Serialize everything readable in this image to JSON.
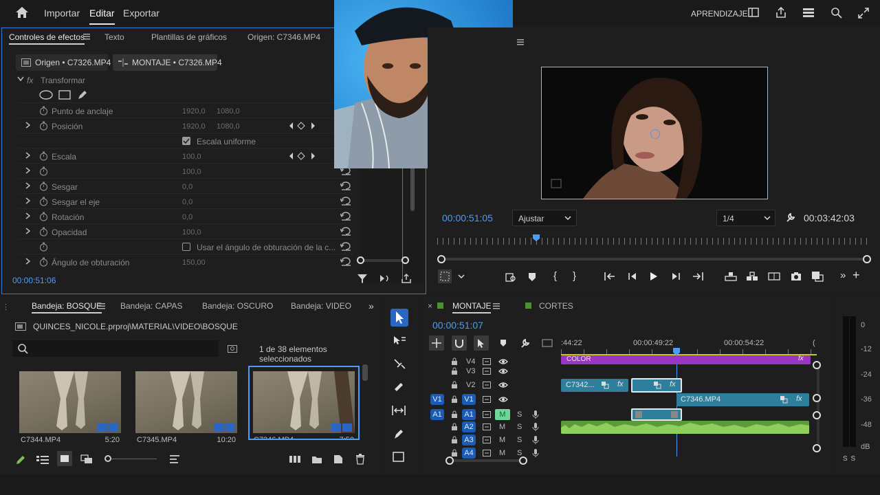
{
  "colors": {
    "accent": "#4d9cf6",
    "track_badge": "#1b5bb4",
    "clip_teal": "#2e7f9c",
    "clip_purple": "#9a35c4",
    "audio_green": "#7fbd52"
  },
  "top": {
    "nav": [
      "Importar",
      "Editar",
      "Exportar"
    ],
    "active": "Editar",
    "learning": "APRENDIZAJE"
  },
  "effects": {
    "tabs": [
      "Controles de efectos",
      "Texto",
      "Plantillas de gráficos",
      "Origen: C7346.MP4"
    ],
    "source_btn": "Origen • C7326.MP4",
    "sequence_btn": "MONTAJE • C7326.MP4",
    "section": "Transformar",
    "rows": [
      {
        "name": "Punto de anclaje",
        "v1": "1920,0",
        "v2": "1080,0",
        "chev": false,
        "kf": false,
        "reset": false
      },
      {
        "name": "Posición",
        "v1": "1920,0",
        "v2": "1080,0",
        "chev": true,
        "kf": true,
        "reset": false
      },
      {
        "name": "",
        "v1": "",
        "v2": "",
        "chev": false,
        "kf": false,
        "reset": false,
        "checkbox": true,
        "check_label": "Escala uniforme"
      },
      {
        "name": "Escala",
        "v1": "100,0",
        "v2": "",
        "chev": true,
        "kf": true,
        "reset": false
      },
      {
        "name": "",
        "v1": "100,0",
        "v2": "",
        "chev": true,
        "kf": false,
        "reset": true
      },
      {
        "name": "Sesgar",
        "v1": "0,0",
        "v2": "",
        "chev": true,
        "kf": false,
        "reset": true
      },
      {
        "name": "Sesgar el eje",
        "v1": "0,0",
        "v2": "",
        "chev": true,
        "kf": false,
        "reset": true
      },
      {
        "name": "Rotación",
        "v1": "0,0",
        "v2": "",
        "chev": true,
        "kf": false,
        "reset": true
      },
      {
        "name": "Opacidad",
        "v1": "100,0",
        "v2": "",
        "chev": true,
        "kf": false,
        "reset": true
      },
      {
        "name": "",
        "v1": "",
        "v2": "",
        "chev": false,
        "kf": false,
        "reset": true,
        "checkbox2": true,
        "check_label": "Usar el ángulo de obturación de la c..."
      },
      {
        "name": "Ángulo de obturación",
        "v1": "150,00",
        "v2": "",
        "chev": true,
        "kf": false,
        "reset": true
      }
    ],
    "timecode": "00:00:51:06"
  },
  "monitor": {
    "timecode": "00:00:51:05",
    "fit": "Ajustar",
    "resolution": "1/4",
    "duration": "00:03:42:03"
  },
  "bin": {
    "tabs": [
      "Bandeja: BOSQUE",
      "Bandeja: CAPAS",
      "Bandeja: OSCURO",
      "Bandeja: VIDEO"
    ],
    "path": "QUINCES_NICOLE.prproj\\MATERIAL\\VIDEO\\BOSQUE",
    "search_placeholder": "",
    "selection_count": "1 de 38 elementos seleccionados",
    "items": [
      {
        "name": "C7344.MP4",
        "duration": "5:20"
      },
      {
        "name": "C7345.MP4",
        "duration": "10:20"
      },
      {
        "name": "C7346.MP4",
        "duration": "7:50"
      }
    ]
  },
  "timeline": {
    "tabs": [
      "MONTAJE",
      "CORTES"
    ],
    "timecode": "00:00:51:07",
    "ruler": [
      ":44:22",
      "00:00:49:22",
      "00:00:54:22",
      "("
    ],
    "tracks": {
      "video": [
        "V4",
        "V3",
        "V2",
        "V1"
      ],
      "audio": [
        "A1",
        "A2",
        "A3",
        "A4"
      ]
    },
    "clips": {
      "color": "COLOR",
      "v2a": "C7342...",
      "v1": "C7346.MP4"
    },
    "src_v1": "V1",
    "src_a1": "A1",
    "m": "M",
    "s": "S"
  },
  "meters": {
    "labels": [
      "0",
      "-12",
      "-24",
      "-36",
      "-48",
      "dB"
    ],
    "bottom": "S S"
  }
}
